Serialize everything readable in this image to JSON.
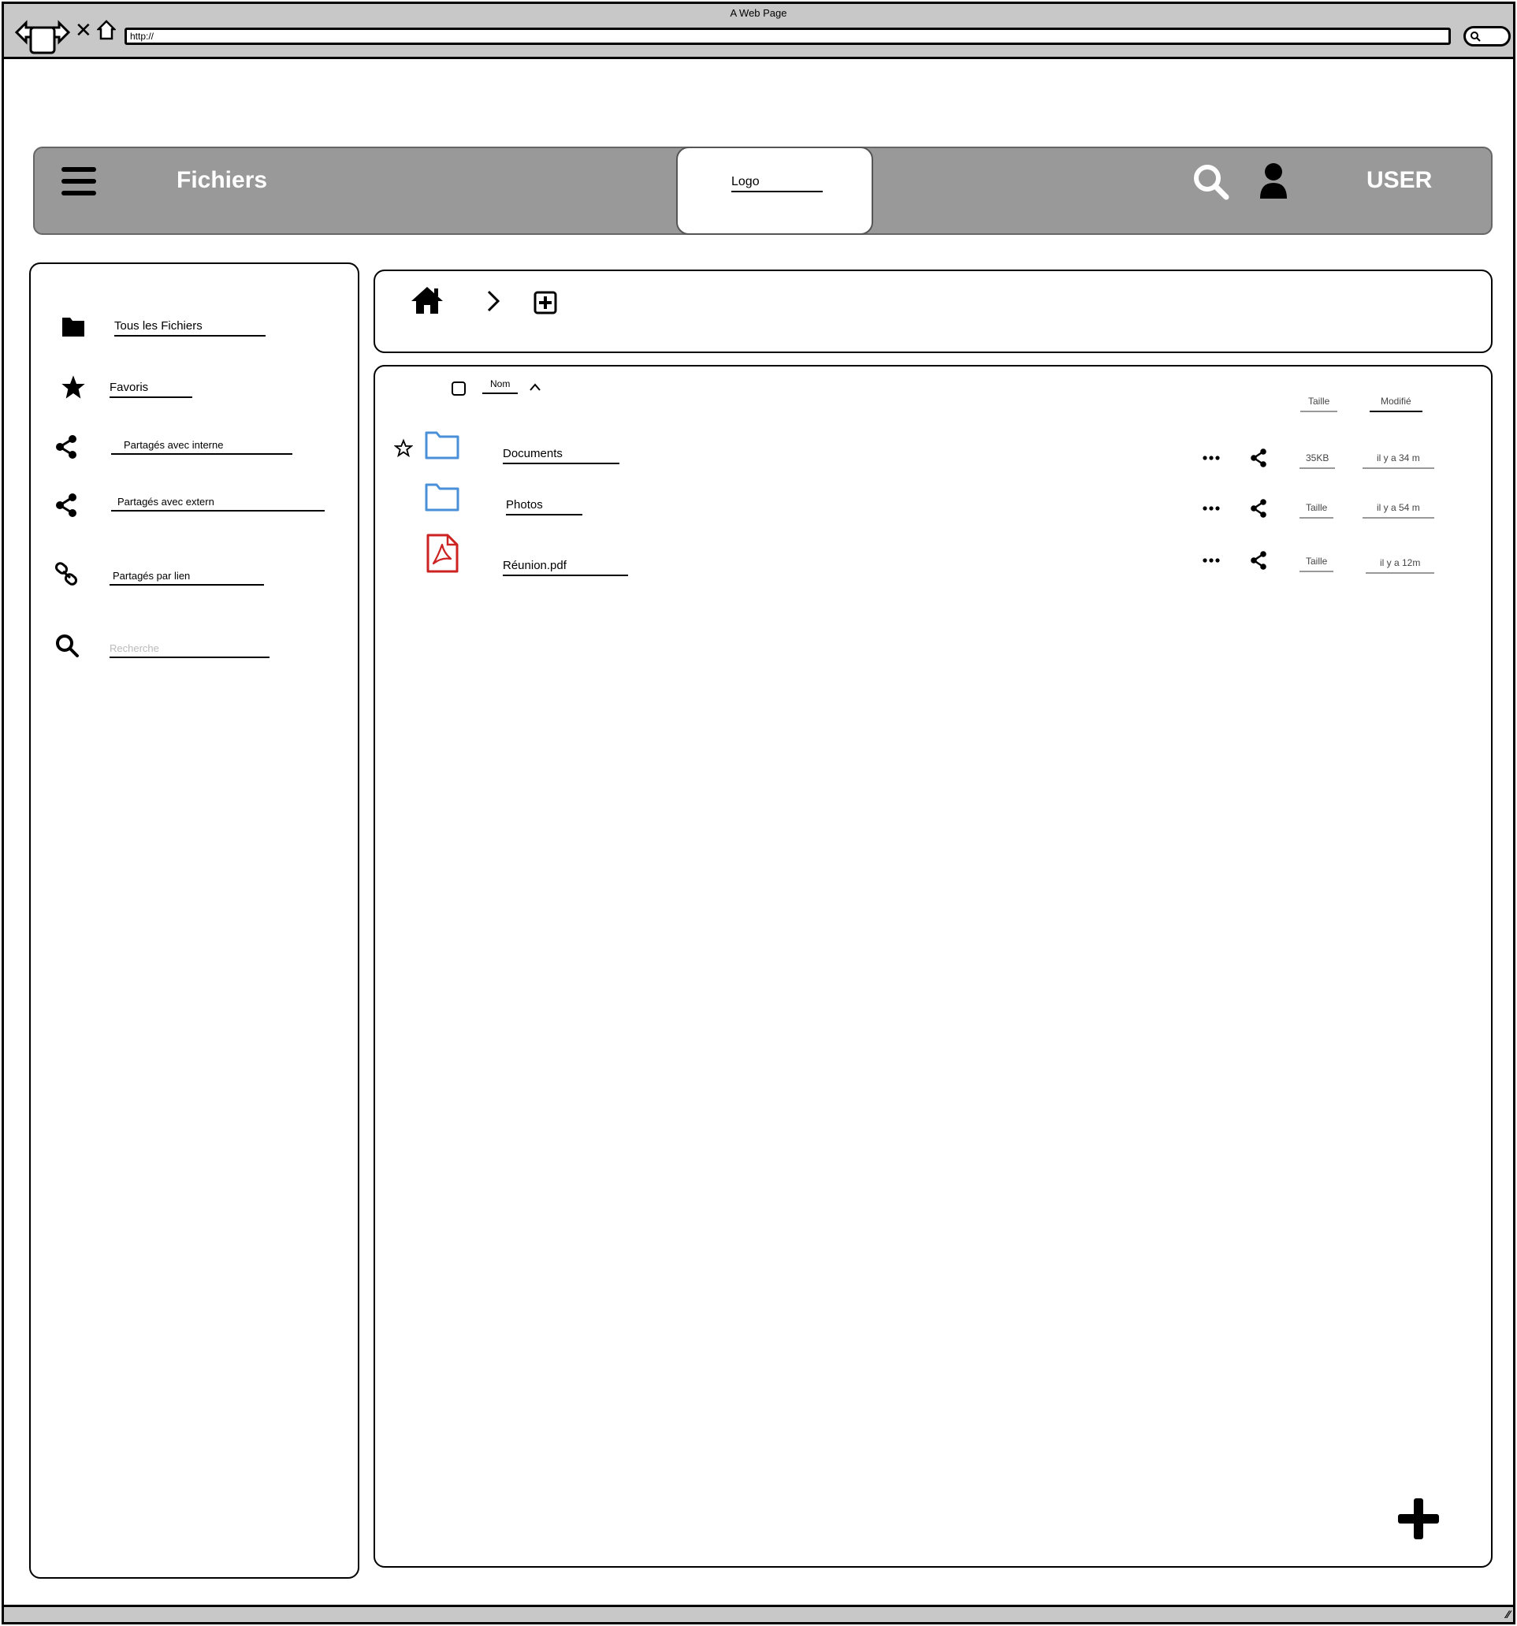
{
  "browser": {
    "window_title": "A Web Page",
    "url": "http://"
  },
  "header": {
    "title": "Fichiers",
    "logo_label": "Logo",
    "user_label": "USER",
    "menu_icon": "hamburger-menu-icon",
    "search_icon": "search-icon",
    "user_icon": "user-icon",
    "background": "#999999"
  },
  "sidebar": {
    "items": [
      {
        "label": "Tous les Fichiers",
        "icon": "folder-icon"
      },
      {
        "label": "Favoris",
        "icon": "star-icon"
      },
      {
        "label": "Partagés avec interne",
        "icon": "share-icon"
      },
      {
        "label": "Partagés avec extern",
        "icon": "share-icon"
      },
      {
        "label": "Partagés par lien",
        "icon": "link-icon"
      }
    ],
    "search_placeholder": "Recherche"
  },
  "breadcrumb": {
    "home_icon": "home-icon",
    "separator_icon": "chevron-right-icon",
    "add_icon": "plus-square-icon"
  },
  "file_list": {
    "columns": {
      "name": "Nom",
      "size": "Taille",
      "modified": "Modifié"
    },
    "rows": [
      {
        "name": "Documents",
        "type": "folder",
        "size": "35KB",
        "modified": "il y a 34 m",
        "starred_outline": true
      },
      {
        "name": "Photos",
        "type": "folder",
        "size": "Taille",
        "modified": "il y a 54 m",
        "starred_outline": false
      },
      {
        "name": "Réunion.pdf",
        "type": "pdf",
        "size": "Taille",
        "modified": "il y a 12m",
        "starred_outline": false
      }
    ],
    "folder_color": "#4a90d9",
    "pdf_color": "#cc2222"
  }
}
